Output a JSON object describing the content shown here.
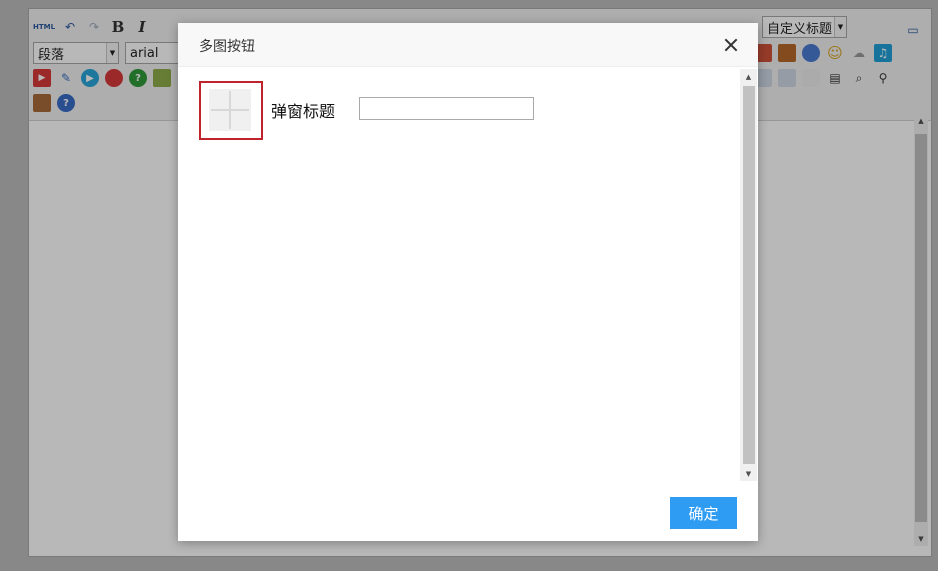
{
  "editor": {
    "toolbar": {
      "paragraph_select": "段落",
      "font_select": "arial",
      "custom_title_select": "自定义标题",
      "html_label": "HTML",
      "bold_label": "B",
      "italic_label": "I"
    }
  },
  "dialog": {
    "title": "多图按钮",
    "field_label": "弹窗标题",
    "field_value": "",
    "ok_label": "确定"
  },
  "colors": {
    "accent": "#2d9cf2",
    "highlight_border": "#c0232b",
    "overlay": "rgba(0,0,0,0.28)"
  }
}
